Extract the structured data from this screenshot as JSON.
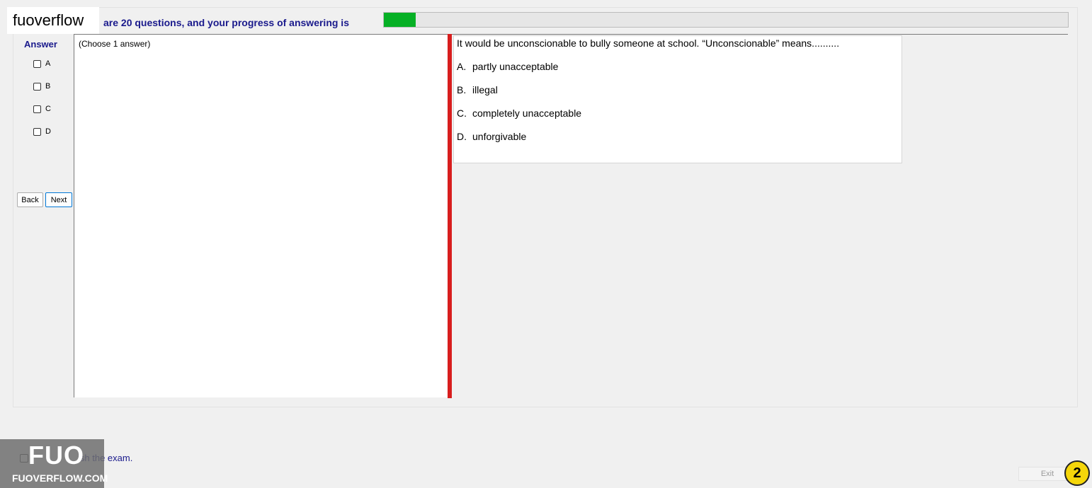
{
  "brand_label": "fuoverflow",
  "progress": {
    "text": "are 20 questions, and your progress of answering is",
    "fraction": 0.047,
    "fill_color": "#06b025"
  },
  "answer_panel": {
    "title": "Answer",
    "options": [
      "A",
      "B",
      "C",
      "D"
    ]
  },
  "nav": {
    "back_label": "Back",
    "next_label": "Next"
  },
  "left_pane": {
    "instruction": "(Choose 1 answer)"
  },
  "question": {
    "text": "It would be unconscionable to bully someone at school. “Unconscionable” means..........",
    "options": [
      {
        "letter": "A.",
        "text": "partly unacceptable"
      },
      {
        "letter": "B.",
        "text": "illegal"
      },
      {
        "letter": "C.",
        "text": "completely unacceptable"
      },
      {
        "letter": "D.",
        "text": "unforgivable"
      }
    ]
  },
  "finish": {
    "label": "ish the exam."
  },
  "logo": {
    "big": "FUO",
    "small": "FUOVERFLOW.COM"
  },
  "exit_label": "Exit",
  "badge_number": "2",
  "colors": {
    "splitter": "#d81e1e",
    "heading": "#1a1a8c",
    "badge": "#f5d60a"
  }
}
